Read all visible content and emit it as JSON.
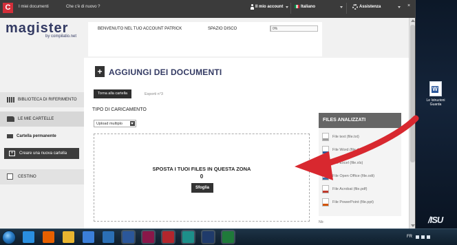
{
  "topbar": {
    "brand": "C",
    "links": [
      "I miei documenti",
      "Che c'è di nuovo ?"
    ],
    "account": "Il mio account",
    "language": "Italiano",
    "help": "Assistenza",
    "close": "×"
  },
  "header": {
    "logo": "magister",
    "logo_sub": "by compilatio.net",
    "welcome": "BENVENUTO NEL TUO ACCOUNT PATRICK",
    "disk_label": "SPAZIO DISCO",
    "disk_percent": "0%",
    "disk_used": 0
  },
  "sidebar": {
    "items": [
      {
        "label": "BIBLIOTECA DI RIFERIMENTO",
        "icon": "library-icon"
      },
      {
        "label": "LE MIE CARTELLE",
        "icon": "folder-icon"
      },
      {
        "label": "Cartella permanente",
        "icon": "folder-icon"
      },
      {
        "label": "CESTINO",
        "icon": "trash-icon"
      }
    ],
    "new_folder_button": "Creare una nuova cartella"
  },
  "main": {
    "title": "AGGIUNGI DEI DOCUMENTI",
    "back_button": "Torna alla cartella",
    "export": "Esporti n°3",
    "upload_type_label": "TIPO DI CARICAMENTO",
    "upload_select_value": "Upload multiplo",
    "drop_text": "SPOSTA I TUOI FILES IN QUESTA ZONA",
    "drop_count": "0",
    "browse_button": "Sfoglia"
  },
  "files_panel": {
    "header": "FILES ANALIZZATI",
    "files": [
      {
        "label": "File text (file.txt)",
        "color": "#9e9e9e"
      },
      {
        "label": "File Word (file.doc)",
        "color": "#2b579a"
      },
      {
        "label": "File Excel (file.xls)",
        "color": "#1f7a3a"
      },
      {
        "label": "File Open Office (file.odt)",
        "color": "#3a6ea5"
      },
      {
        "label": "File Acrobat (file.pdf)",
        "color": "#c0392b"
      },
      {
        "label": "File PowerPoint (file.ppt)",
        "color": "#d35400"
      }
    ],
    "notes": "Nb:"
  },
  "desktop": {
    "icon_label": "Le Istruzioni Guarda",
    "brand": "/ISU"
  },
  "taskbar": {
    "apps": [
      {
        "name": "ie-icon",
        "color": "#2a8fe0"
      },
      {
        "name": "firefox-icon",
        "color": "#e66000"
      },
      {
        "name": "explorer-icon",
        "color": "#e9b530"
      },
      {
        "name": "media-icon",
        "color": "#3b7fd9"
      },
      {
        "name": "outlook-icon",
        "color": "#2b6fb5"
      },
      {
        "name": "word-icon",
        "color": "#2b579a"
      },
      {
        "name": "indesign-icon",
        "color": "#8a1749"
      },
      {
        "name": "filezilla-icon",
        "color": "#b3262d"
      },
      {
        "name": "app-green-icon",
        "color": "#1d8f8a"
      },
      {
        "name": "photoshop-icon",
        "color": "#1f3b6b"
      },
      {
        "name": "excel-icon",
        "color": "#1f7a3a"
      }
    ],
    "tray_lang": "FR",
    "time": "",
    "date": ""
  },
  "colors": {
    "accent": "#333a63",
    "brand_red": "#d32f3a",
    "arrow_red": "#d8282f"
  }
}
